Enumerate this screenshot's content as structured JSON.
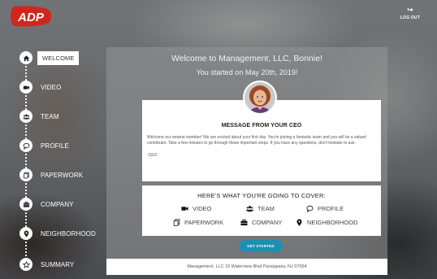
{
  "header": {
    "logo_text": "ADP",
    "logout_label": "LOG OUT"
  },
  "nav": {
    "items": [
      {
        "label": "WELCOME",
        "icon": "home-icon",
        "active": true
      },
      {
        "label": "VIDEO",
        "icon": "video-icon"
      },
      {
        "label": "TEAM",
        "icon": "team-icon"
      },
      {
        "label": "PROFILE",
        "icon": "chat-icon"
      },
      {
        "label": "PAPERWORK",
        "icon": "documents-icon"
      },
      {
        "label": "COMPANY",
        "icon": "briefcase-icon"
      },
      {
        "label": "NEIGHBORHOOD",
        "icon": "map-pin-icon"
      },
      {
        "label": "SUMMARY",
        "icon": "star-icon"
      }
    ]
  },
  "main": {
    "title": "Welcome to Management, LLC, Bonnie!",
    "subtitle": "You started on May 20th, 2019!",
    "ceo_card": {
      "title": "MESSAGE FROM YOUR CEO",
      "message": "Welcome our newest member! We are excited about your first day. You're joining a fantastic team and you will be a valued contributor. Take a few minutes to go through these important steps. If you have any questions, don't hesitate to ask.",
      "signature": "-CEO"
    },
    "cover_card": {
      "title": "HERE'S WHAT YOU'RE GOING TO COVER:",
      "items": [
        {
          "label": "VIDEO",
          "icon": "video-icon"
        },
        {
          "label": "TEAM",
          "icon": "team-icon"
        },
        {
          "label": "PROFILE",
          "icon": "chat-icon"
        },
        {
          "label": "PAPERWORK",
          "icon": "documents-icon"
        },
        {
          "label": "COMPANY",
          "icon": "briefcase-icon"
        },
        {
          "label": "NEIGHBORHOOD",
          "icon": "map-pin-icon"
        }
      ]
    },
    "cta_label": "GET STARTED",
    "footer": "Management, LLC 15 Waterview Blvd Parsippany, NJ 07054"
  },
  "colors": {
    "brand_red": "#d0271d",
    "button_blue": "#1d8fb1"
  }
}
